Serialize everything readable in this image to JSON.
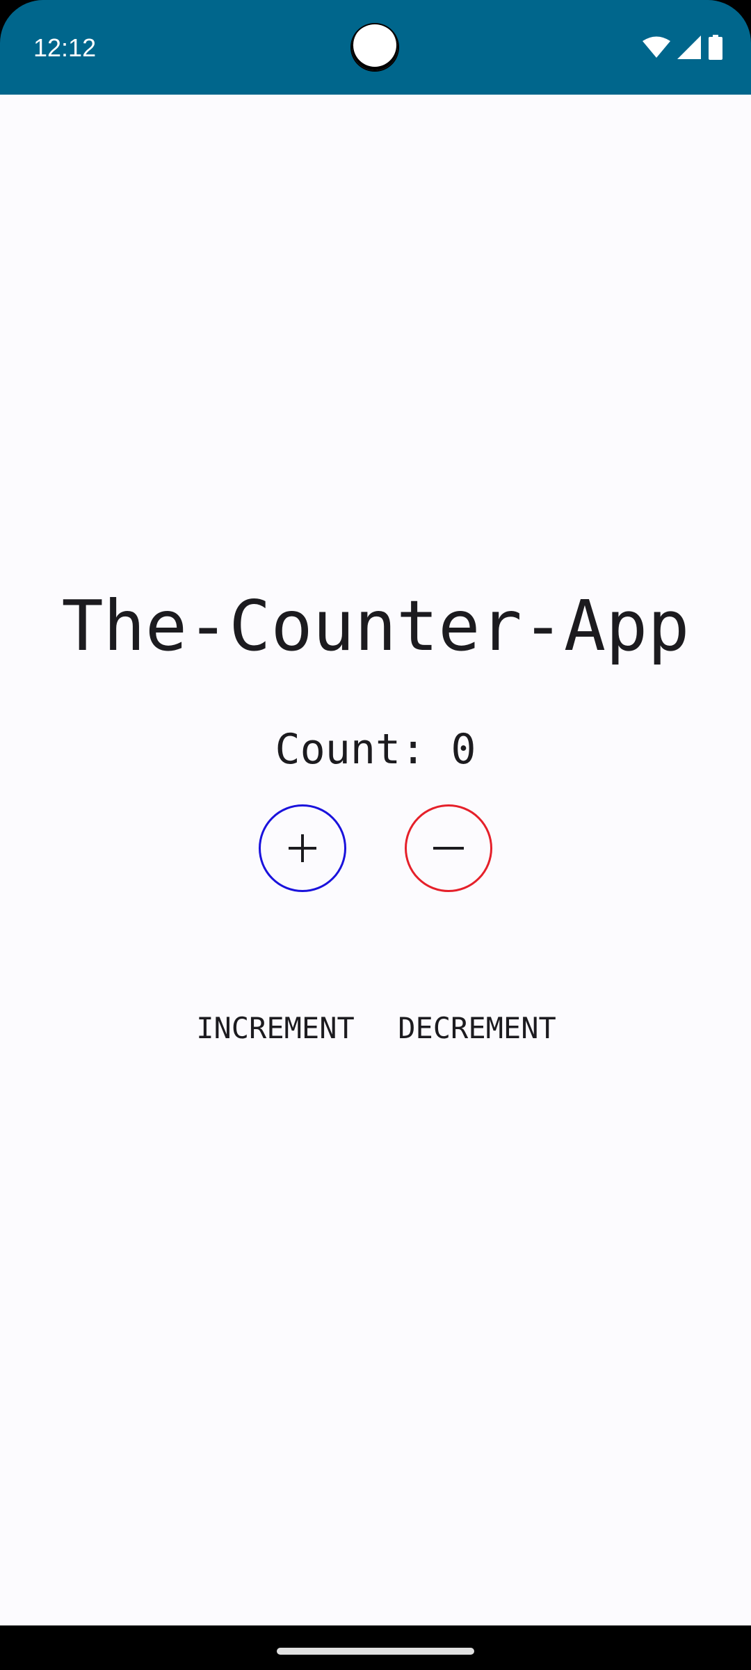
{
  "status_bar": {
    "time": "12:12",
    "background_color": "#00668c",
    "icons": [
      "wifi-icon",
      "cellular-signal-icon",
      "battery-icon"
    ]
  },
  "app": {
    "title": "The-Counter-App",
    "count_text": "Count: 0",
    "count_value": 0,
    "increment": {
      "symbol": "+",
      "label": "INCREMENT",
      "border_color": "#1a12dc"
    },
    "decrement": {
      "symbol": "−",
      "label": "DECREMENT",
      "border_color": "#e5202a"
    }
  }
}
